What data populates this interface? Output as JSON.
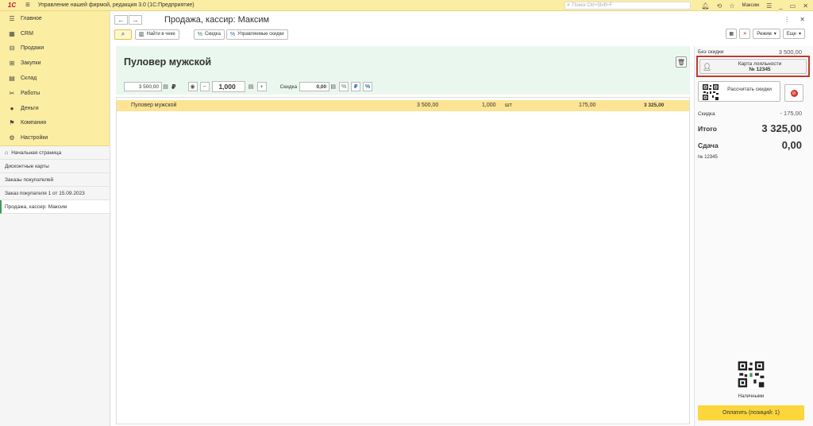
{
  "titlebar": {
    "logo": "1C",
    "app_title": "Управление нашей фирмой, редакция 3.0  (1С:Предприятие)",
    "search_placeholder": "Поиск Ctrl+Shift+F",
    "user": "Максим"
  },
  "sidebar": {
    "sections": [
      {
        "label": "Главное",
        "icon": "menu-lines-icon"
      },
      {
        "label": "CRM",
        "icon": "crm-icon"
      },
      {
        "label": "Продажи",
        "icon": "cart-icon"
      },
      {
        "label": "Закупки",
        "icon": "basket-icon"
      },
      {
        "label": "Склад",
        "icon": "warehouse-icon"
      },
      {
        "label": "Работы",
        "icon": "tools-icon"
      },
      {
        "label": "Деньги",
        "icon": "money-icon"
      },
      {
        "label": "Компания",
        "icon": "flag-icon"
      },
      {
        "label": "Настройки",
        "icon": "gear-icon"
      }
    ],
    "nav": [
      {
        "label": "Начальная страница"
      },
      {
        "label": "Дисконтные карты"
      },
      {
        "label": "Заказы покупателей"
      },
      {
        "label": "Заказ покупателя 1 от 15.09.2023"
      },
      {
        "label": "Продажа, кассир: Максим"
      }
    ]
  },
  "doc": {
    "title": "Продажа, кассир: Максим",
    "toolbar": {
      "find_in_receipt": "Найти в чеке",
      "discount": "Скидка",
      "managed_discounts": "Управляемые скидки",
      "mode": "Режим",
      "more": "Еще"
    }
  },
  "product": {
    "name": "Пуловер мужской",
    "price": "3 500,00",
    "currency": "₽",
    "quantity": "1,000",
    "discount_label": "Скидка",
    "discount_value": "0,00"
  },
  "table": {
    "rows": [
      {
        "name": "Пуловер мужской",
        "price": "3 500,00",
        "qty": "1,000",
        "unit": "шт",
        "discount": "175,00",
        "sum": "3 325,00"
      }
    ]
  },
  "panel": {
    "without_discount_label": "Без скидки",
    "without_discount_value": "3 500,00",
    "loyalty_label": "Карта лояльности",
    "loyalty_number": "№ 12345",
    "calc_discounts": "Рассчитать скидки",
    "discount_label": "Скидка",
    "discount_value": "- 175,00",
    "total_label": "Итого",
    "total_value": "3 325,00",
    "change_label": "Сдача",
    "change_value": "0,00",
    "card_number": "№ 12345",
    "payment_method": "Наличными",
    "pay_button": "Оплатить (позиций: 1)"
  }
}
